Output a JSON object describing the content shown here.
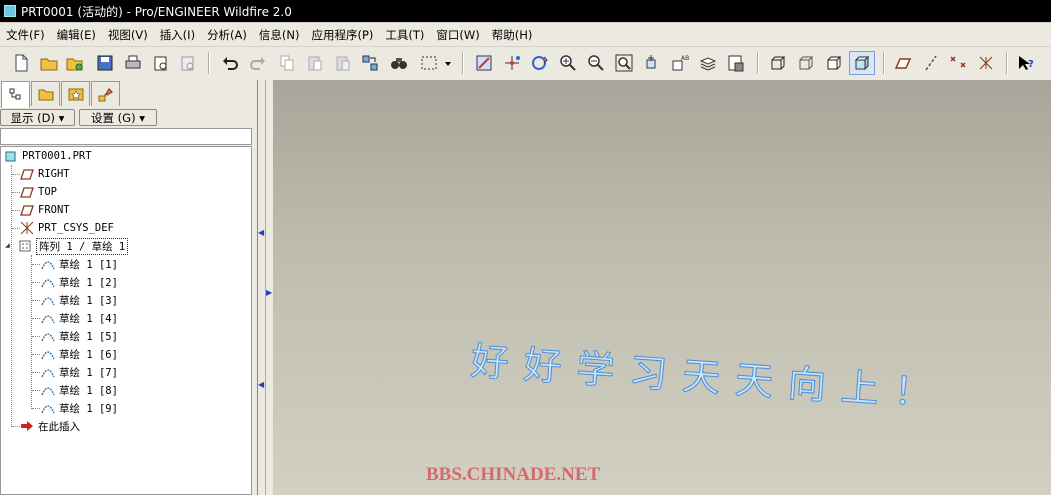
{
  "window": {
    "title": "PRT0001 (活动的) - Pro/ENGINEER Wildfire 2.0"
  },
  "menu": [
    "文件(F)",
    "编辑(E)",
    "视图(V)",
    "插入(I)",
    "分析(A)",
    "信息(N)",
    "应用程序(P)",
    "工具(T)",
    "窗口(W)",
    "帮助(H)"
  ],
  "panel": {
    "show_label": "显示 (D) ▾",
    "settings_label": "设置 (G) ▾"
  },
  "tree": {
    "root": "PRT0001.PRT",
    "planes": [
      "RIGHT",
      "TOP",
      "FRONT"
    ],
    "csys": "PRT_CSYS_DEF",
    "pattern": "阵列 1 / 草绘 1",
    "sketches": [
      "草绘 1 [1]",
      "草绘 1 [2]",
      "草绘 1 [3]",
      "草绘 1 [4]",
      "草绘 1 [5]",
      "草绘 1 [6]",
      "草绘 1 [7]",
      "草绘 1 [8]",
      "草绘 1 [9]"
    ],
    "insert_here": "在此插入"
  },
  "viewport": {
    "text": "好好学习天天向上！",
    "watermark": "BBS.CHINADE.NET"
  },
  "colors": {
    "titlebar": "#000000",
    "accent": "#4a90d8",
    "watermark": "#d66a6a"
  }
}
